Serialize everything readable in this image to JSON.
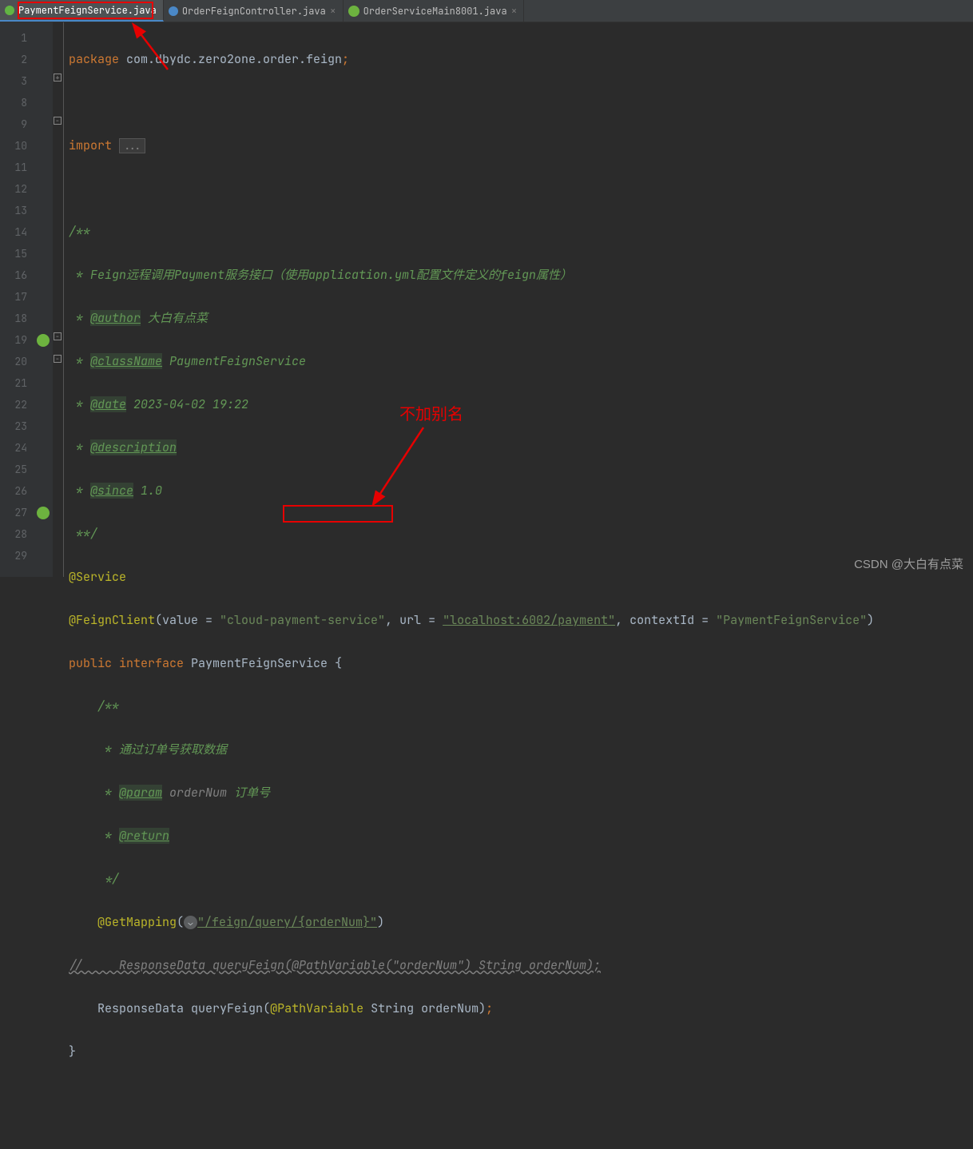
{
  "tabs": [
    {
      "label": "PaymentFeignService.java",
      "iconClass": "icon-java",
      "active": true
    },
    {
      "label": "OrderFeignController.java",
      "iconClass": "icon-ctrl",
      "active": false
    },
    {
      "label": "OrderServiceMain8001.java",
      "iconClass": "icon-spring",
      "active": false
    }
  ],
  "lineNumbers": [
    "1",
    "2",
    "3",
    "8",
    "9",
    "10",
    "11",
    "12",
    "13",
    "14",
    "15",
    "16",
    "17",
    "18",
    "19",
    "20",
    "21",
    "22",
    "23",
    "24",
    "25",
    "26",
    "27",
    "28",
    "29"
  ],
  "code": {
    "packageKw": "package ",
    "packagePath": "com.dbydc.zero2one.order.feign",
    "semi": ";",
    "importKw": "import ",
    "importFolded": "...",
    "docStart": "/**",
    "docL1a": " * Feign远程调用Payment服务接口（使用application.yml配置文件定义的feign属性）",
    "docAuthorTag": "@author",
    "docAuthorTxt": " 大白有点菜",
    "docClassTag": "@className",
    "docClassTxt": " PaymentFeignService",
    "docDateTag": "@date",
    "docDateTxt": " 2023-04-02 19:22",
    "docDescTag": "@description",
    "docSinceTag": "@since",
    "docSinceTxt": " 1.0",
    "docEnd": " **/",
    "annService": "@Service",
    "annFeign": "@FeignClient",
    "feignValueK": "value = ",
    "feignValueV": "\"cloud-payment-service\"",
    "feignUrlK": ", url = ",
    "feignUrlV": "\"localhost:6002/payment\"",
    "feignCtxK": ", contextId = ",
    "feignCtxV": "\"PaymentFeignService\"",
    "publicKw": "public interface ",
    "ifaceName": "PaymentFeignService",
    "openBr": " {",
    "mdocStart": "    /**",
    "mdocL1": "     * 通过订单号获取数据",
    "mdocParamTag": "@param",
    "mdocParamName": "orderNum",
    "mdocParamDesc": " 订单号",
    "mdocReturnTag": "@return",
    "mdocEnd": "     */",
    "annGet": "@GetMapping",
    "getPath": "\"/feign/query/{orderNum}\"",
    "commentedSig": "//     ResponseData queryFeign(@PathVariable(\"orderNum\") String orderNum);",
    "retType": "ResponseData",
    "methodName": "queryFeign",
    "annPathVar": "@PathVariable",
    "paramType": "String",
    "paramName": "orderNum",
    "closeBr": "}"
  },
  "annotations": {
    "redText": "不加别名",
    "watermark": "CSDN @大白有点菜"
  }
}
